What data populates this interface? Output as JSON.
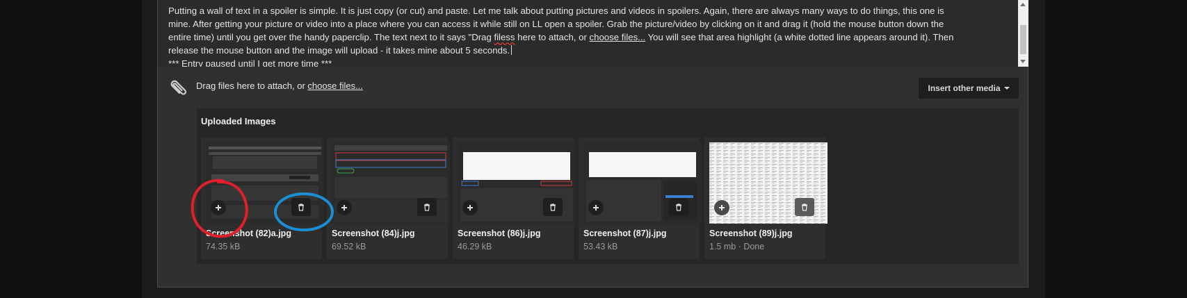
{
  "editor": {
    "text_lines": [
      "Putting a wall of text in a spoiler is simple. It is just copy (or cut) and paste. Let me talk about putting pictures and videos in spoilers. Again, there are always many ways to do things, this one is",
      "mine. After getting your picture or video into a place where you can access it while still on LL open a spoiler. Grab the picture/video by clicking on it and drag it (hold the mouse button down the",
      "entire time) until you get over the handy paperclip. The text next to it says \"Drag ",
      "filess",
      " here to attach, or ",
      "choose files...",
      " You will see that area highlight (a white dotted line appears around it). Then",
      "release the mouse button and the image will upload - it takes mine about 5 seconds.",
      "*** Entry paused until I get more time ***"
    ]
  },
  "attach": {
    "drag_prefix": "Drag files here to attach, or ",
    "choose_link": "choose files...",
    "insert_media_label": "Insert other media"
  },
  "uploads": {
    "title": "Uploaded Images",
    "items": [
      {
        "name": "Screenshot (82)a.jpg",
        "size": "74.35 kB"
      },
      {
        "name": "Screenshot (84)j.jpg",
        "size": "69.52 kB"
      },
      {
        "name": "Screenshot (86)j.jpg",
        "size": "46.29 kB"
      },
      {
        "name": "Screenshot (87)j.jpg",
        "size": "53.43 kB"
      },
      {
        "name": "Screenshot (89)j.jpg",
        "size": "1.5 mb · Done"
      }
    ]
  },
  "icons": {
    "paperclip": "paperclip-icon",
    "add": "plus-icon",
    "delete": "trash-icon"
  },
  "colors": {
    "annotation_red": "#e0202a",
    "annotation_blue": "#1b8fd6"
  }
}
